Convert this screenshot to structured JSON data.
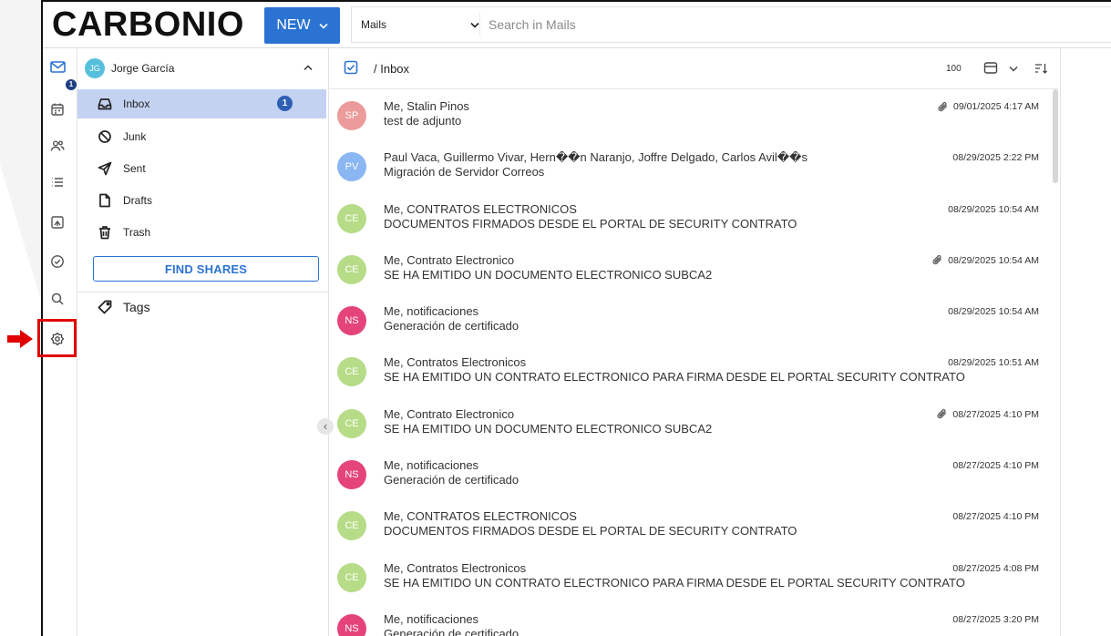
{
  "header": {
    "logo": "CARBONIO",
    "new_button": "NEW",
    "search_scope": "Mails",
    "search_placeholder": "Search in Mails"
  },
  "rail": {
    "items": [
      {
        "icon": "mail-icon",
        "badge": "1",
        "active": true
      },
      {
        "icon": "calendar-icon"
      },
      {
        "icon": "contacts-icon"
      },
      {
        "icon": "list-icon"
      },
      {
        "icon": "files-icon"
      },
      {
        "icon": "check-circle-icon"
      },
      {
        "icon": "search-icon"
      },
      {
        "icon": "settings-icon",
        "highlighted": true
      }
    ]
  },
  "account": {
    "initials": "JG",
    "name": "Jorge García",
    "avatar_color": "#56bfdc"
  },
  "folders": [
    {
      "label": "Inbox",
      "icon": "inbox-icon",
      "unread": "1",
      "selected": true
    },
    {
      "label": "Junk",
      "icon": "junk-icon"
    },
    {
      "label": "Sent",
      "icon": "sent-icon"
    },
    {
      "label": "Drafts",
      "icon": "drafts-icon"
    },
    {
      "label": "Trash",
      "icon": "trash-icon"
    }
  ],
  "find_shares": "FIND SHARES",
  "tags_label": "Tags",
  "list": {
    "path": "/ Inbox",
    "page_size": "100"
  },
  "messages": [
    {
      "initials": "SP",
      "avatar_color": "#ec9b9b",
      "from": "Me, Stalin Pinos",
      "subject": "test de adjunto",
      "date": "09/01/2025 4:17 AM",
      "attachment": true
    },
    {
      "initials": "PV",
      "avatar_color": "#8ab6f2",
      "from": "Paul Vaca, Guillermo Vivar, Hern��n Naranjo, Joffre Delgado, Carlos Avil��s",
      "subject": "Migración de Servidor Correos",
      "date": "08/29/2025 2:22 PM",
      "attachment": false
    },
    {
      "initials": "CE",
      "avatar_color": "#b6dc87",
      "from": "Me, CONTRATOS ELECTRONICOS",
      "subject": "DOCUMENTOS FIRMADOS DESDE EL PORTAL DE SECURITY CONTRATO",
      "date": "08/29/2025 10:54 AM",
      "attachment": false
    },
    {
      "initials": "CE",
      "avatar_color": "#b6dc87",
      "from": "Me, Contrato Electronico",
      "subject": "SE HA EMITIDO UN DOCUMENTO ELECTRONICO SUBCA2",
      "date": "08/29/2025 10:54 AM",
      "attachment": true
    },
    {
      "initials": "NS",
      "avatar_color": "#e5447b",
      "from": "Me, notificaciones",
      "subject": "Generación de certificado",
      "date": "08/29/2025 10:54 AM",
      "attachment": false
    },
    {
      "initials": "CE",
      "avatar_color": "#b6dc87",
      "from": "Me, Contratos Electronicos",
      "subject": "SE HA EMITIDO UN CONTRATO ELECTRONICO PARA FIRMA DESDE EL PORTAL SECURITY CONTRATO",
      "date": "08/29/2025 10:51 AM",
      "attachment": false
    },
    {
      "initials": "CE",
      "avatar_color": "#b6dc87",
      "from": "Me, Contrato Electronico",
      "subject": "SE HA EMITIDO UN DOCUMENTO ELECTRONICO SUBCA2",
      "date": "08/27/2025 4:10 PM",
      "attachment": true
    },
    {
      "initials": "NS",
      "avatar_color": "#e5447b",
      "from": "Me, notificaciones",
      "subject": "Generación de certificado",
      "date": "08/27/2025 4:10 PM",
      "attachment": false
    },
    {
      "initials": "CE",
      "avatar_color": "#b6dc87",
      "from": "Me, CONTRATOS ELECTRONICOS",
      "subject": "DOCUMENTOS FIRMADOS DESDE EL PORTAL DE SECURITY CONTRATO",
      "date": "08/27/2025 4:10 PM",
      "attachment": false
    },
    {
      "initials": "CE",
      "avatar_color": "#b6dc87",
      "from": "Me, Contratos Electronicos",
      "subject": "SE HA EMITIDO UN CONTRATO ELECTRONICO PARA FIRMA DESDE EL PORTAL SECURITY CONTRATO",
      "date": "08/27/2025 4:08 PM",
      "attachment": false
    },
    {
      "initials": "NS",
      "avatar_color": "#e5447b",
      "from": "Me, notificaciones",
      "subject": "Generación de certificado",
      "date": "08/27/2025 3:20 PM",
      "attachment": false
    }
  ],
  "colors": {
    "primary": "#2b73d2",
    "selected_folder": "#c4d2f2",
    "unread_badge": "#2f5fb5",
    "annotation_red": "#e00000"
  }
}
